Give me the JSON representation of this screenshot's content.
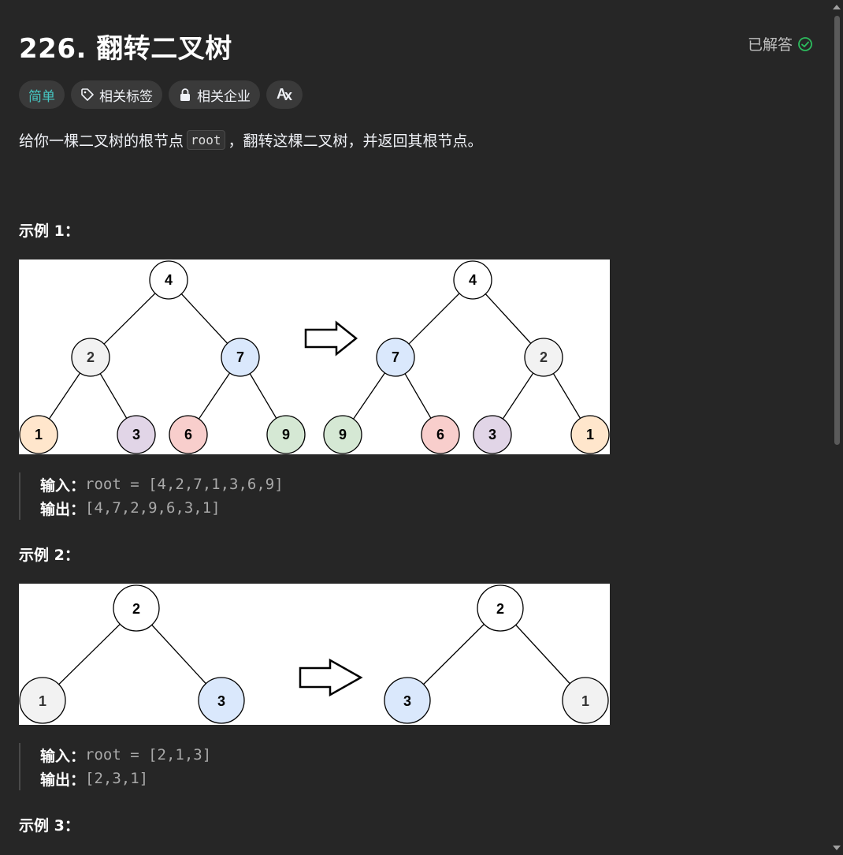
{
  "problem": {
    "title": "226. 翻转二叉树",
    "status": "已解答",
    "tags": {
      "difficulty": "简单",
      "related_tags": "相关标签",
      "related_companies": "相关企业"
    },
    "description_before": "给你一棵二叉树的根节点",
    "description_code": "root",
    "description_after": "，翻转这棵二叉树，并返回其根节点。"
  },
  "examples": [
    {
      "title": "示例 1：",
      "input_label": "输入：",
      "input_value": "root = [4,2,7,1,3,6,9]",
      "output_label": "输出：",
      "output_value": "[4,7,2,9,6,3,1]",
      "left_tree": [
        "4",
        "2",
        "7",
        "1",
        "3",
        "6",
        "9"
      ],
      "right_tree": [
        "4",
        "7",
        "2",
        "9",
        "6",
        "3",
        "1"
      ]
    },
    {
      "title": "示例 2：",
      "input_label": "输入：",
      "input_value": "root = [2,1,3]",
      "output_label": "输出：",
      "output_value": "[2,3,1]",
      "left_tree": [
        "2",
        "1",
        "3"
      ],
      "right_tree": [
        "2",
        "3",
        "1"
      ]
    },
    {
      "title": "示例 3："
    }
  ],
  "colors": {
    "node_white": "#ffffff",
    "node_gray": "#f2f2f2",
    "node_blue": "#dae8fc",
    "node_orange": "#ffe6cc",
    "node_purple": "#e1d5e7",
    "node_red": "#f8cecc",
    "node_green": "#d5e8d4",
    "easy": "#46c6c2",
    "solved_check": "#2cbb5d"
  }
}
